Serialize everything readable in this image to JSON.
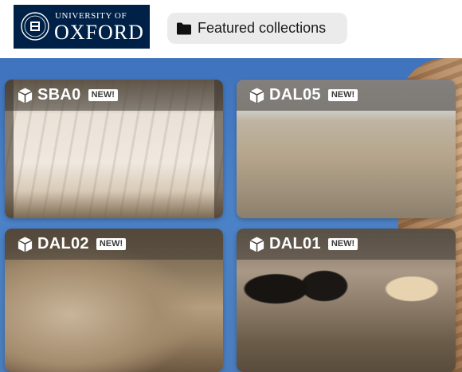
{
  "logo": {
    "line1": "UNIVERSITY OF",
    "line2": "OXFORD"
  },
  "nav": {
    "featured_label": "Featured collections"
  },
  "cards": [
    {
      "title": "SBA0",
      "badge": "NEW!"
    },
    {
      "title": "DAL05",
      "badge": "NEW!"
    },
    {
      "title": "DAL02",
      "badge": "NEW!"
    },
    {
      "title": "DAL01",
      "badge": "NEW!"
    }
  ],
  "colors": {
    "brand_navy": "#002147",
    "background_blue": "#4a7dbe"
  },
  "icons": {
    "folder": "folder-icon",
    "card": "cube-icon",
    "crest": "crest-icon"
  }
}
